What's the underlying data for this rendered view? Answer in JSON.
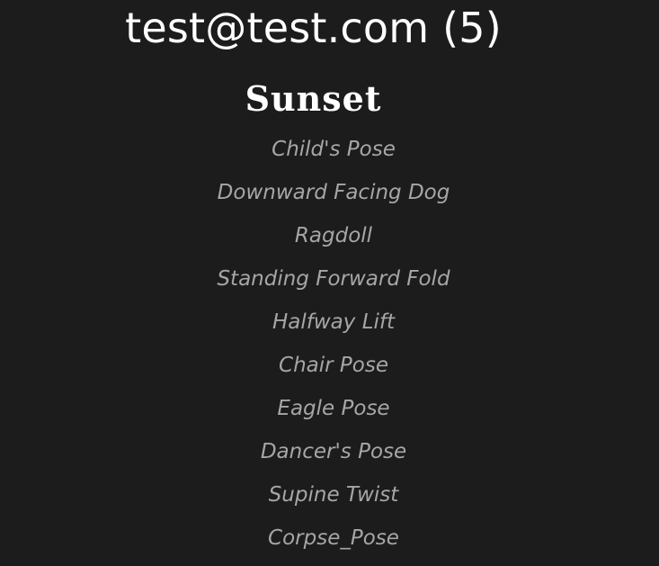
{
  "header": {
    "title": "test@test.com (5)"
  },
  "playlist": {
    "title": "Sunset",
    "poses": [
      "Child's Pose",
      "Downward Facing Dog",
      "Ragdoll",
      "Standing Forward Fold",
      "Halfway Lift",
      "Chair Pose",
      "Eagle Pose",
      "Dancer's Pose",
      "Supine Twist",
      "Corpse_Pose"
    ]
  }
}
